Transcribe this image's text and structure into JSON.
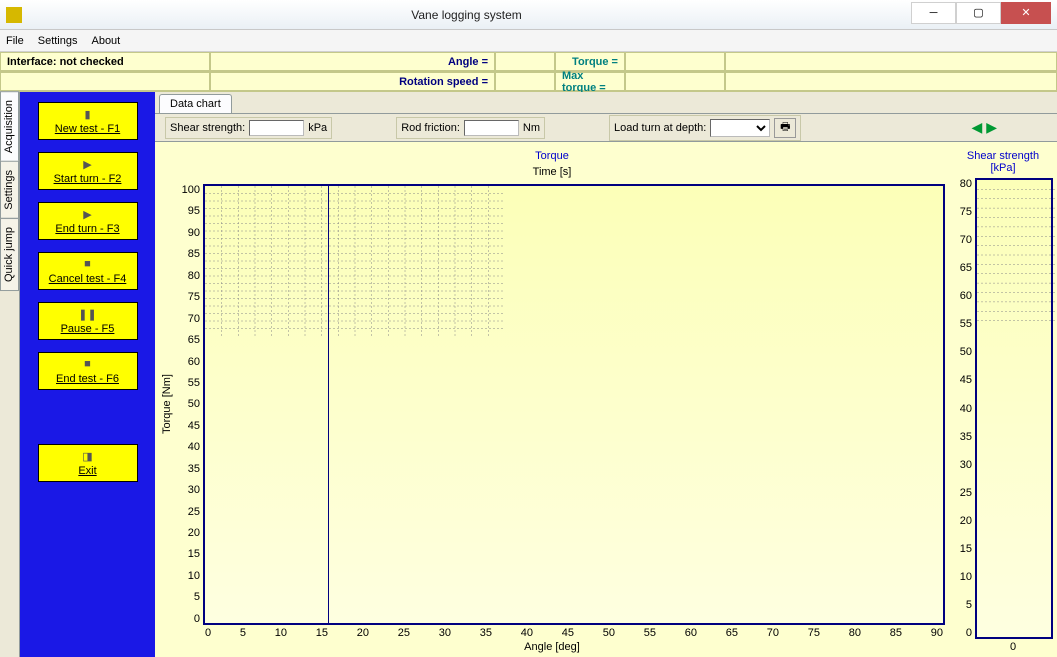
{
  "window": {
    "title": "Vane logging system"
  },
  "menu": {
    "file": "File",
    "settings": "Settings",
    "about": "About"
  },
  "status": {
    "interface": "Interface: not checked",
    "angle_lbl": "Angle =",
    "angle_val": "",
    "torque_lbl": "Torque =",
    "torque_val": "",
    "rotspeed_lbl": "Rotation speed =",
    "rotspeed_val": "",
    "maxtorque_lbl": "Max torque =",
    "maxtorque_val": ""
  },
  "vtabs": {
    "acq": "Acquisition",
    "set": "Settings",
    "qj": "Quick jump"
  },
  "sidebar": {
    "new": "New test - F1",
    "start": "Start turn - F2",
    "end": "End turn - F3",
    "cancel": "Cancel test - F4",
    "pause": "Pause - F5",
    "endtest": "End test - F6",
    "exit": "Exit"
  },
  "tabs": {
    "datachart": "Data chart"
  },
  "fields": {
    "shear_lbl": "Shear strength:",
    "shear_unit": "kPa",
    "rod_lbl": "Rod friction:",
    "rod_unit": "Nm",
    "load_lbl": "Load turn at depth:"
  },
  "chart_data": {
    "type": "line",
    "title": "Torque",
    "subtitle": "Time [s]",
    "xlabel": "Angle [deg]",
    "ylabel": "Torque [Nm]",
    "xlim": [
      0,
      90
    ],
    "ylim": [
      0,
      100
    ],
    "x_ticks": [
      0,
      5,
      10,
      15,
      20,
      25,
      30,
      35,
      40,
      45,
      50,
      55,
      60,
      65,
      70,
      75,
      80,
      85,
      90
    ],
    "y_ticks": [
      0,
      5,
      10,
      15,
      20,
      25,
      30,
      35,
      40,
      45,
      50,
      55,
      60,
      65,
      70,
      75,
      80,
      85,
      90,
      95,
      100
    ],
    "series": [],
    "cursor_x": 15
  },
  "side_chart": {
    "type": "bar",
    "title": "Shear strength [kPa]",
    "ylim": [
      0,
      80
    ],
    "y_ticks": [
      0,
      5,
      10,
      15,
      20,
      25,
      30,
      35,
      40,
      45,
      50,
      55,
      60,
      65,
      70,
      75,
      80
    ],
    "categories": [
      "0"
    ],
    "values": []
  }
}
